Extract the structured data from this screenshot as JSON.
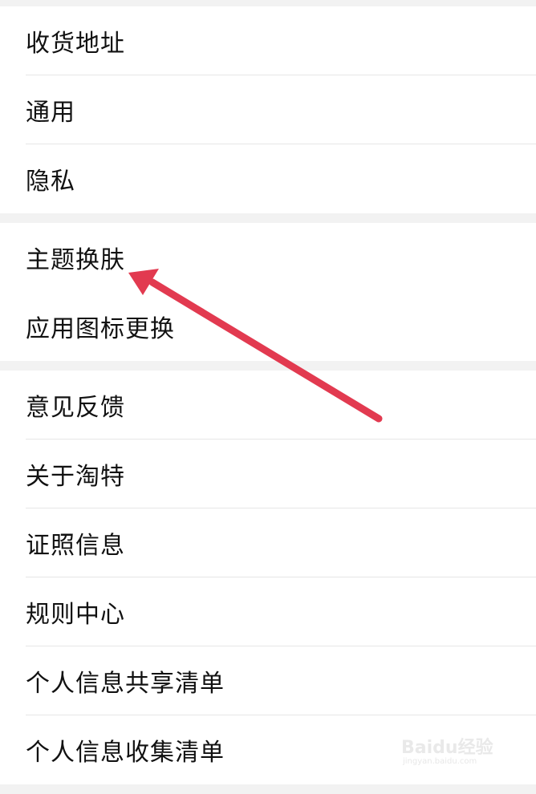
{
  "groups": [
    {
      "items": [
        {
          "label": "收货地址"
        },
        {
          "label": "通用"
        },
        {
          "label": "隐私"
        }
      ]
    },
    {
      "items": [
        {
          "label": "主题换肤"
        },
        {
          "label": "应用图标更换"
        }
      ]
    },
    {
      "items": [
        {
          "label": "意见反馈"
        },
        {
          "label": "关于淘特"
        },
        {
          "label": "证照信息"
        },
        {
          "label": "规则中心"
        },
        {
          "label": "个人信息共享清单"
        },
        {
          "label": "个人信息收集清单"
        }
      ]
    }
  ],
  "annotation": {
    "arrow_color": "#e23a50",
    "points_to": "主题换肤"
  },
  "watermark": {
    "brand": "Baidu经验",
    "url": "jingyan.baidu.com"
  },
  "colors": {
    "background": "#f2f2f2",
    "row_background": "#ffffff",
    "text": "#111111",
    "divider": "#e6e6e6"
  }
}
